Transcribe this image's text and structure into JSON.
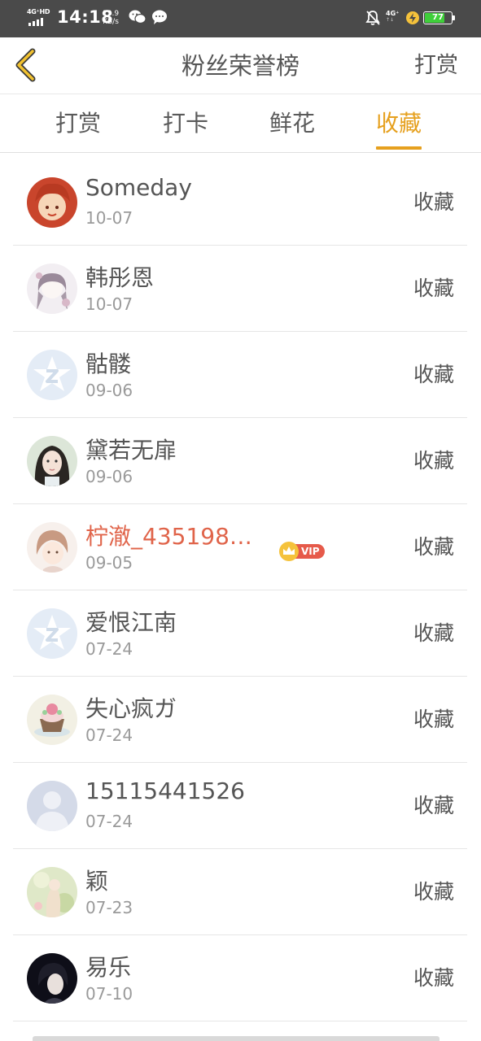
{
  "status_bar": {
    "network_label": "4G⁺HD",
    "time": "14:18",
    "speed_value": "13.9",
    "speed_unit": "KB/s",
    "network2_label": "4G⁺",
    "battery": "77",
    "battery_level": 0.77,
    "battery_color": "#3fcf3a"
  },
  "header": {
    "title": "粉丝荣誉榜",
    "right_button": "打赏",
    "back_icon": "chevron-left-icon",
    "accent_color": "#e6a01e"
  },
  "tabs": [
    {
      "label": "打赏",
      "active": false
    },
    {
      "label": "打卡",
      "active": false
    },
    {
      "label": "鲜花",
      "active": false
    },
    {
      "label": "收藏",
      "active": true
    }
  ],
  "fans": [
    {
      "name": "Someday",
      "date": "10-07",
      "action": "收藏",
      "vip": false
    },
    {
      "name": "韩彤恩",
      "date": "10-07",
      "action": "收藏",
      "vip": false
    },
    {
      "name": "骷髅",
      "date": "09-06",
      "action": "收藏",
      "vip": false
    },
    {
      "name": "黛若无扉",
      "date": "09-06",
      "action": "收藏",
      "vip": false
    },
    {
      "name": "柠澈_435198…",
      "date": "09-05",
      "action": "收藏",
      "vip": true,
      "vip_label": "VIP"
    },
    {
      "name": "爱恨江南",
      "date": "07-24",
      "action": "收藏",
      "vip": false
    },
    {
      "name": "失心疯ガ",
      "date": "07-24",
      "action": "收藏",
      "vip": false
    },
    {
      "name": "15115441526",
      "date": "07-24",
      "action": "收藏",
      "vip": false
    },
    {
      "name": "颖",
      "date": "07-23",
      "action": "收藏",
      "vip": false
    },
    {
      "name": "易乐",
      "date": "07-10",
      "action": "收藏",
      "vip": false
    }
  ]
}
